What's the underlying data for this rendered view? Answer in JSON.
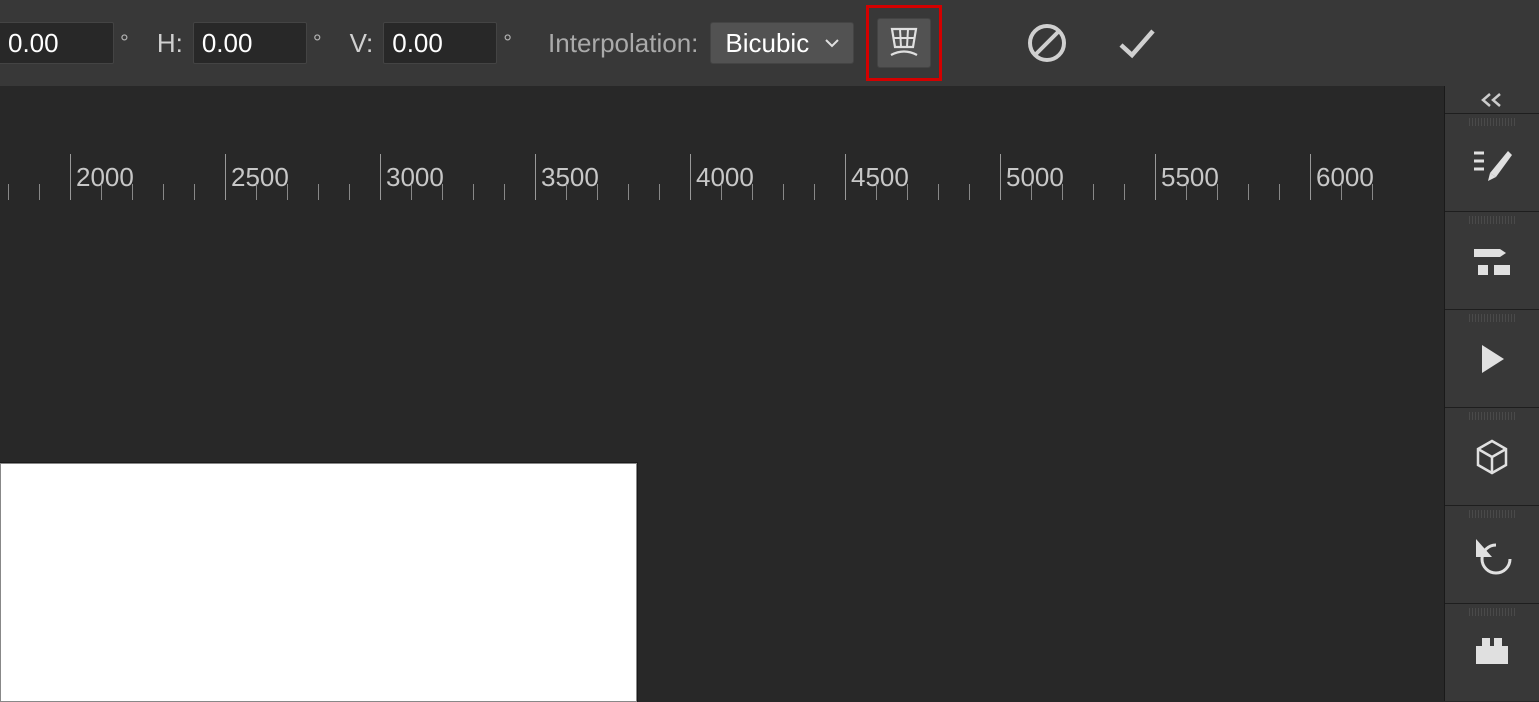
{
  "toolbar": {
    "field1_value": "0.00",
    "h_label": "H:",
    "h_value": "0.00",
    "v_label": "V:",
    "v_value": "0.00",
    "degree": "°",
    "interp_label": "Interpolation:",
    "interp_selected": "Bicubic"
  },
  "ruler": {
    "ticks": [
      2000,
      2500,
      3000,
      3500,
      4000,
      4500,
      5000,
      5500,
      6000
    ]
  }
}
